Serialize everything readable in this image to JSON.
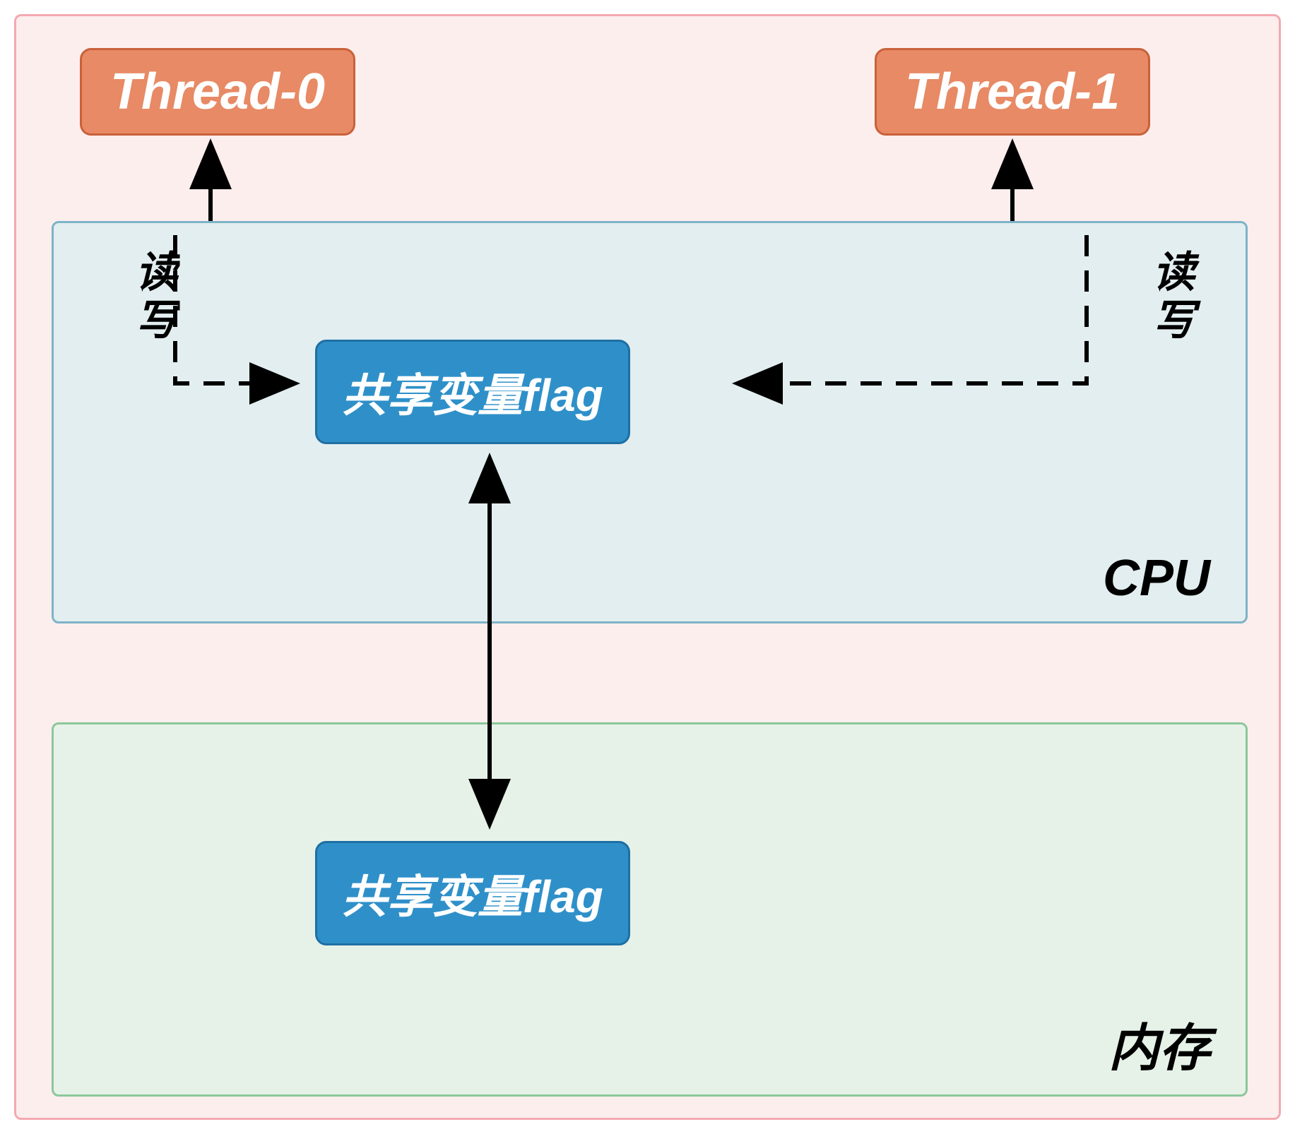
{
  "threads": {
    "t0": "Thread-0",
    "t1": "Thread-1"
  },
  "cpu": {
    "label": "CPU",
    "shared_flag": "共享变量flag"
  },
  "memory": {
    "label": "内存",
    "shared_flag": "共享变量flag"
  },
  "rw": {
    "left": "读写",
    "right": "读写"
  }
}
